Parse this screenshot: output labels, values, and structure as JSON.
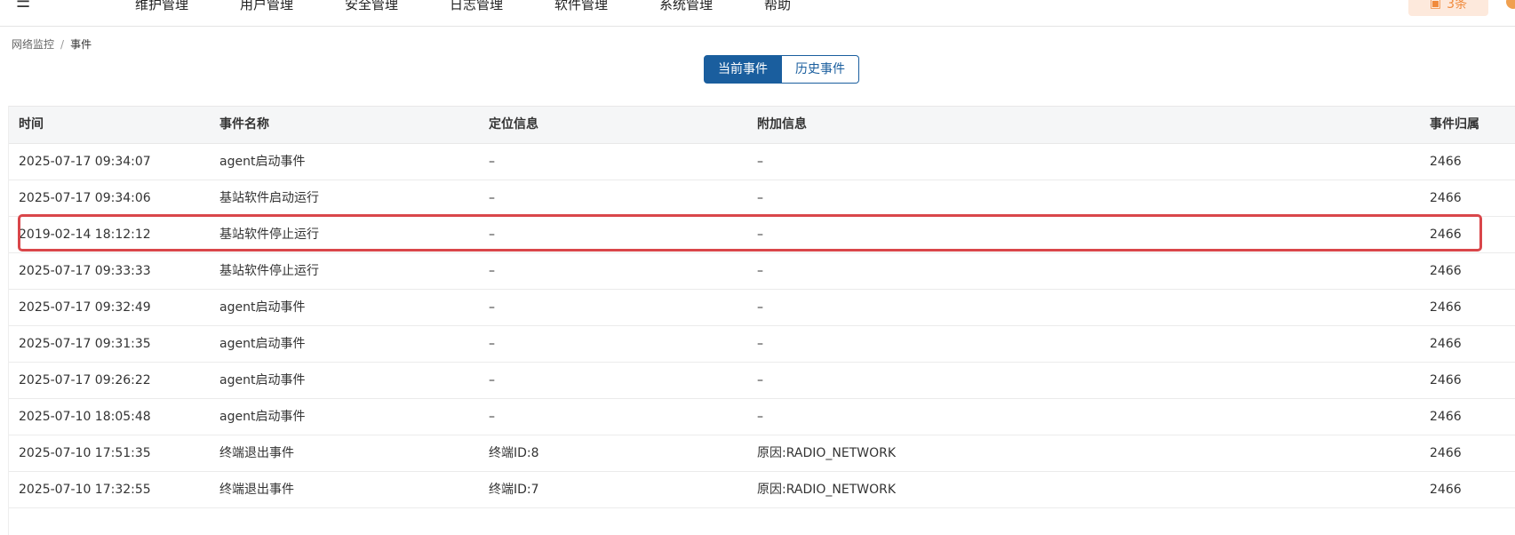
{
  "topnav": {
    "items": [
      "维护管理",
      "用户管理",
      "安全管理",
      "日志管理",
      "软件管理",
      "系统管理",
      "帮助"
    ],
    "alert_count": "3条"
  },
  "breadcrumb": {
    "parent": "网络监控",
    "current": "事件"
  },
  "tabs": [
    {
      "label": "当前事件",
      "active": true
    },
    {
      "label": "历史事件",
      "active": false
    }
  ],
  "table": {
    "headers": [
      "时间",
      "事件名称",
      "定位信息",
      "附加信息",
      "事件归属"
    ],
    "rows": [
      [
        "2025-07-17 09:34:07",
        "agent启动事件",
        "–",
        "–",
        "2466"
      ],
      [
        "2025-07-17 09:34:06",
        "基站软件启动运行",
        "–",
        "–",
        "2466"
      ],
      [
        "2019-02-14 18:12:12",
        "基站软件停止运行",
        "–",
        "–",
        "2466"
      ],
      [
        "2025-07-17 09:33:33",
        "基站软件停止运行",
        "–",
        "–",
        "2466"
      ],
      [
        "2025-07-17 09:32:49",
        "agent启动事件",
        "–",
        "–",
        "2466"
      ],
      [
        "2025-07-17 09:31:35",
        "agent启动事件",
        "–",
        "–",
        "2466"
      ],
      [
        "2025-07-17 09:26:22",
        "agent启动事件",
        "–",
        "–",
        "2466"
      ],
      [
        "2025-07-10 18:05:48",
        "agent启动事件",
        "–",
        "–",
        "2466"
      ],
      [
        "2025-07-10 17:51:35",
        "终端退出事件",
        "终端ID:8",
        "原因:RADIO_NETWORK",
        "2466"
      ],
      [
        "2025-07-10 17:32:55",
        "终端退出事件",
        "终端ID:7",
        "原因:RADIO_NETWORK",
        "2466"
      ]
    ],
    "highlighted_row": 2
  },
  "colors": {
    "primary": "#1a5e9e",
    "highlight": "#d9464a",
    "alert": "#f08a3c"
  }
}
